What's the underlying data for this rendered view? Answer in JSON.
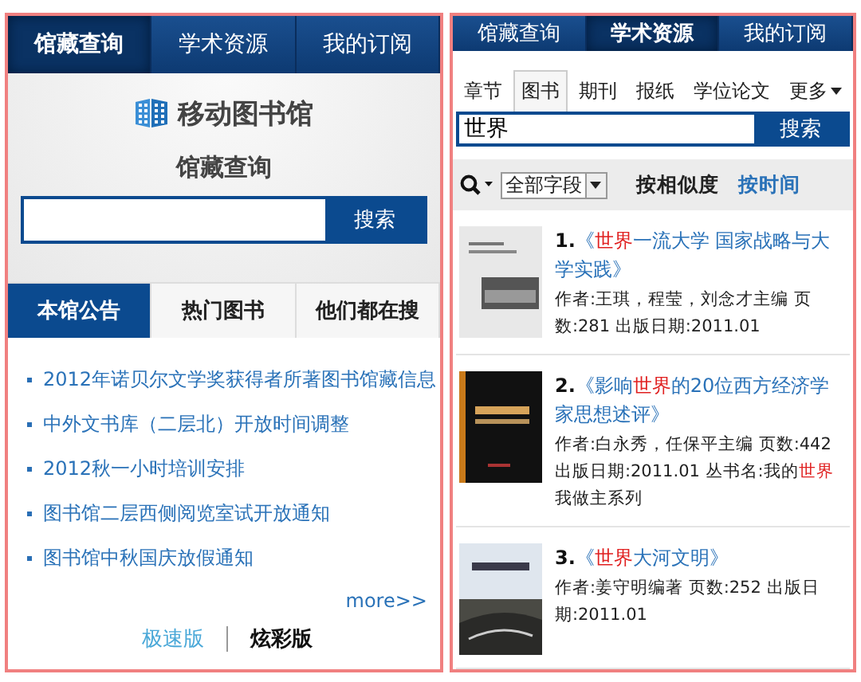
{
  "left_screen": {
    "tabs": [
      {
        "label": "馆藏查询",
        "selected": true
      },
      {
        "label": "学术资源",
        "selected": false
      },
      {
        "label": "我的订阅",
        "selected": false
      }
    ],
    "logo_text": "移动图书馆",
    "heading": "馆藏查询",
    "search": {
      "button": "搜索"
    },
    "news_tabs": [
      {
        "label": "本馆公告",
        "selected": true
      },
      {
        "label": "热门图书",
        "selected": false
      },
      {
        "label": "他们都在搜",
        "selected": false
      }
    ],
    "news": [
      "2012年诺贝尔文学奖获得者所著图书馆藏信息",
      "中外文书库（二层北）开放时间调整",
      "2012秋一小时培训安排",
      "图书馆二层西侧阅览室试开放通知",
      "图书馆中秋国庆放假通知"
    ],
    "more": "more>>",
    "versions": [
      {
        "label": "极速版",
        "selected": false
      },
      {
        "label": "炫彩版",
        "selected": true
      }
    ]
  },
  "right_screen": {
    "tabs": [
      {
        "label": "馆藏查询",
        "selected": false
      },
      {
        "label": "学术资源",
        "selected": true
      },
      {
        "label": "我的订阅",
        "selected": false
      }
    ],
    "categories": [
      {
        "label": "章节",
        "selected": false
      },
      {
        "label": "图书",
        "selected": true
      },
      {
        "label": "期刊",
        "selected": false
      },
      {
        "label": "报纸",
        "selected": false
      },
      {
        "label": "学位论文",
        "selected": false
      },
      {
        "label": "更多",
        "selected": false
      }
    ],
    "search": {
      "value": "世界",
      "button": "搜索"
    },
    "field_select": "全部字段",
    "sorts": [
      {
        "label": "按相似度",
        "selected": true
      },
      {
        "label": "按时间",
        "selected": false
      }
    ],
    "books": [
      {
        "number": "1.",
        "title": [
          {
            "text": "《",
            "hl": false
          },
          {
            "text": "世界",
            "hl": true
          },
          {
            "text": "一流大学 国家战略与大学实践》",
            "hl": false
          }
        ],
        "meta": [
          {
            "text": "作者:王琪，程莹，刘念才主编 页数:281 出版日期:2011.01",
            "hl": false
          }
        ]
      },
      {
        "number": "2.",
        "title": [
          {
            "text": "《影响",
            "hl": false
          },
          {
            "text": "世界",
            "hl": true
          },
          {
            "text": "的20位西方经济学家思想述评》",
            "hl": false
          }
        ],
        "meta": [
          {
            "text": "作者:白永秀，任保平主编 页数:442 出版日期:2011.01 丛书名:我的",
            "hl": false
          },
          {
            "text": "世界",
            "hl": true
          },
          {
            "text": "我做主系列",
            "hl": false
          }
        ]
      },
      {
        "number": "3.",
        "title": [
          {
            "text": "《",
            "hl": false
          },
          {
            "text": "世界",
            "hl": true
          },
          {
            "text": "大河文明》",
            "hl": false
          }
        ],
        "meta": [
          {
            "text": "作者:姜守明编著 页数:252 出版日期:2011.01",
            "hl": false
          }
        ]
      }
    ]
  }
}
